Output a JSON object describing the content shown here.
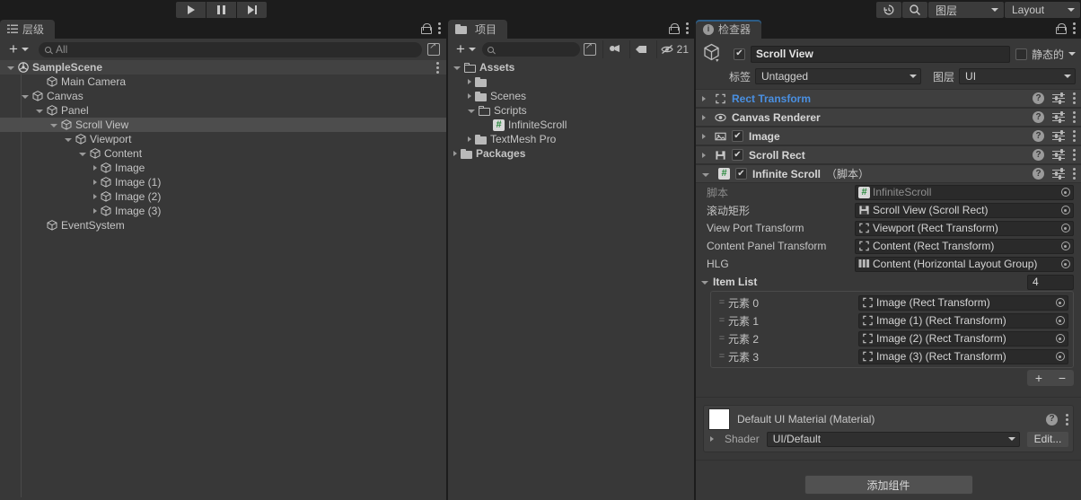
{
  "toolbar": {
    "play_label": "play-icon",
    "pause_label": "pause-icon",
    "step_label": "step-icon",
    "history_icon": "history-icon",
    "search_icon": "search-icon",
    "layers_label": "图层",
    "layout_label": "Layout"
  },
  "hierarchy": {
    "tab_label": "层级",
    "tab_icon": "hierarchy-icon",
    "add_label": "+",
    "search_placeholder": "All",
    "items": [
      {
        "label": "SampleScene",
        "depth": 0,
        "state": "open",
        "icon": "scene-icon",
        "selected": false,
        "scene": true
      },
      {
        "label": "Main Camera",
        "depth": 2,
        "state": "none",
        "icon": "gameobject-icon",
        "selected": false
      },
      {
        "label": "Canvas",
        "depth": 1,
        "state": "open",
        "icon": "gameobject-icon",
        "selected": false
      },
      {
        "label": "Panel",
        "depth": 2,
        "state": "open",
        "icon": "gameobject-icon",
        "selected": false
      },
      {
        "label": "Scroll View",
        "depth": 3,
        "state": "open",
        "icon": "gameobject-icon",
        "selected": true
      },
      {
        "label": "Viewport",
        "depth": 4,
        "state": "open",
        "icon": "gameobject-icon",
        "selected": false
      },
      {
        "label": "Content",
        "depth": 5,
        "state": "open",
        "icon": "gameobject-icon",
        "selected": false
      },
      {
        "label": "Image",
        "depth": 6,
        "state": "closed",
        "icon": "gameobject-icon",
        "selected": false
      },
      {
        "label": "Image (1)",
        "depth": 6,
        "state": "closed",
        "icon": "gameobject-icon",
        "selected": false
      },
      {
        "label": "Image (2)",
        "depth": 6,
        "state": "closed",
        "icon": "gameobject-icon",
        "selected": false
      },
      {
        "label": "Image (3)",
        "depth": 6,
        "state": "closed",
        "icon": "gameobject-icon",
        "selected": false
      },
      {
        "label": "EventSystem",
        "depth": 2,
        "state": "none",
        "icon": "gameobject-icon",
        "selected": false
      }
    ]
  },
  "project": {
    "tab_label": "项目",
    "tab_icon": "folder-icon",
    "add_label": "+",
    "search_placeholder": "",
    "hidden_count": "21",
    "items": [
      {
        "label": "Assets",
        "depth": 0,
        "state": "open",
        "icon": "folder-open-icon",
        "bold": true
      },
      {
        "label": "",
        "depth": 1,
        "state": "closed",
        "icon": "folder-icon",
        "bold": false
      },
      {
        "label": "Scenes",
        "depth": 1,
        "state": "closed",
        "icon": "folder-icon",
        "bold": false
      },
      {
        "label": "Scripts",
        "depth": 1,
        "state": "open",
        "icon": "folder-open-icon",
        "bold": false
      },
      {
        "label": "InfiniteScroll",
        "depth": 2,
        "state": "none",
        "icon": "csharp-script-icon",
        "bold": false
      },
      {
        "label": "TextMesh Pro",
        "depth": 1,
        "state": "closed",
        "icon": "folder-icon",
        "bold": false
      },
      {
        "label": "Packages",
        "depth": 0,
        "state": "closed",
        "icon": "folder-icon",
        "bold": true
      }
    ]
  },
  "inspector": {
    "tab_label": "检查器",
    "tab_icon": "info-icon",
    "object_name": "Scroll View",
    "object_enabled": true,
    "static_label": "静态的",
    "static_checked": false,
    "tag_label": "标签",
    "tag_value": "Untagged",
    "layer_label": "图层",
    "layer_value": "UI",
    "components": [
      {
        "title": "Rect Transform",
        "icon": "rect-transform-icon",
        "expanded": false,
        "has_checkbox": false,
        "checked": false,
        "blue": true,
        "suffix": ""
      },
      {
        "title": "Canvas Renderer",
        "icon": "canvas-renderer-icon",
        "expanded": false,
        "has_checkbox": false,
        "checked": false,
        "blue": false,
        "suffix": ""
      },
      {
        "title": "Image",
        "icon": "image-icon",
        "expanded": false,
        "has_checkbox": true,
        "checked": true,
        "blue": false,
        "suffix": ""
      },
      {
        "title": "Scroll Rect",
        "icon": "scroll-rect-icon",
        "expanded": false,
        "has_checkbox": true,
        "checked": true,
        "blue": false,
        "suffix": ""
      },
      {
        "title": "Infinite Scroll",
        "icon": "csharp-script-icon",
        "expanded": true,
        "has_checkbox": true,
        "checked": true,
        "blue": false,
        "suffix": "（脚本）"
      }
    ],
    "script_props": [
      {
        "label": "脚本",
        "value": "InfiniteScroll",
        "icon": "csharp-script-icon",
        "dim": true
      },
      {
        "label": "滚动矩形",
        "value": "Scroll View (Scroll Rect)",
        "icon": "scroll-rect-icon",
        "dim": false
      },
      {
        "label": "View Port Transform",
        "value": "Viewport (Rect Transform)",
        "icon": "rect-transform-icon",
        "dim": false
      },
      {
        "label": "Content Panel Transform",
        "value": "Content (Rect Transform)",
        "icon": "rect-transform-icon",
        "dim": false
      },
      {
        "label": "HLG",
        "value": "Content (Horizontal Layout Group)",
        "icon": "layout-group-icon",
        "dim": false
      }
    ],
    "item_list": {
      "label": "Item List",
      "size": "4",
      "elements": [
        {
          "label": "元素 0",
          "value": "Image (Rect Transform)",
          "icon": "rect-transform-icon"
        },
        {
          "label": "元素 1",
          "value": "Image (1) (Rect Transform)",
          "icon": "rect-transform-icon"
        },
        {
          "label": "元素 2",
          "value": "Image (2) (Rect Transform)",
          "icon": "rect-transform-icon"
        },
        {
          "label": "元素 3",
          "value": "Image (3) (Rect Transform)",
          "icon": "rect-transform-icon"
        }
      ],
      "add_label": "+",
      "remove_label": "−"
    },
    "material": {
      "name": "Default UI Material (Material)",
      "shader_label": "Shader",
      "shader_value": "UI/Default",
      "edit_label": "Edit...",
      "swatch_color": "#ffffff"
    },
    "add_component_label": "添加组件"
  },
  "colors": {
    "panel_bg": "#383838",
    "toolbar_bg": "#1c1c1c",
    "component_bg": "#3f3f3f",
    "selection": "#4d4d4d",
    "accent_blue": "#4a90e2",
    "tab_accent": "#2c5d87"
  }
}
